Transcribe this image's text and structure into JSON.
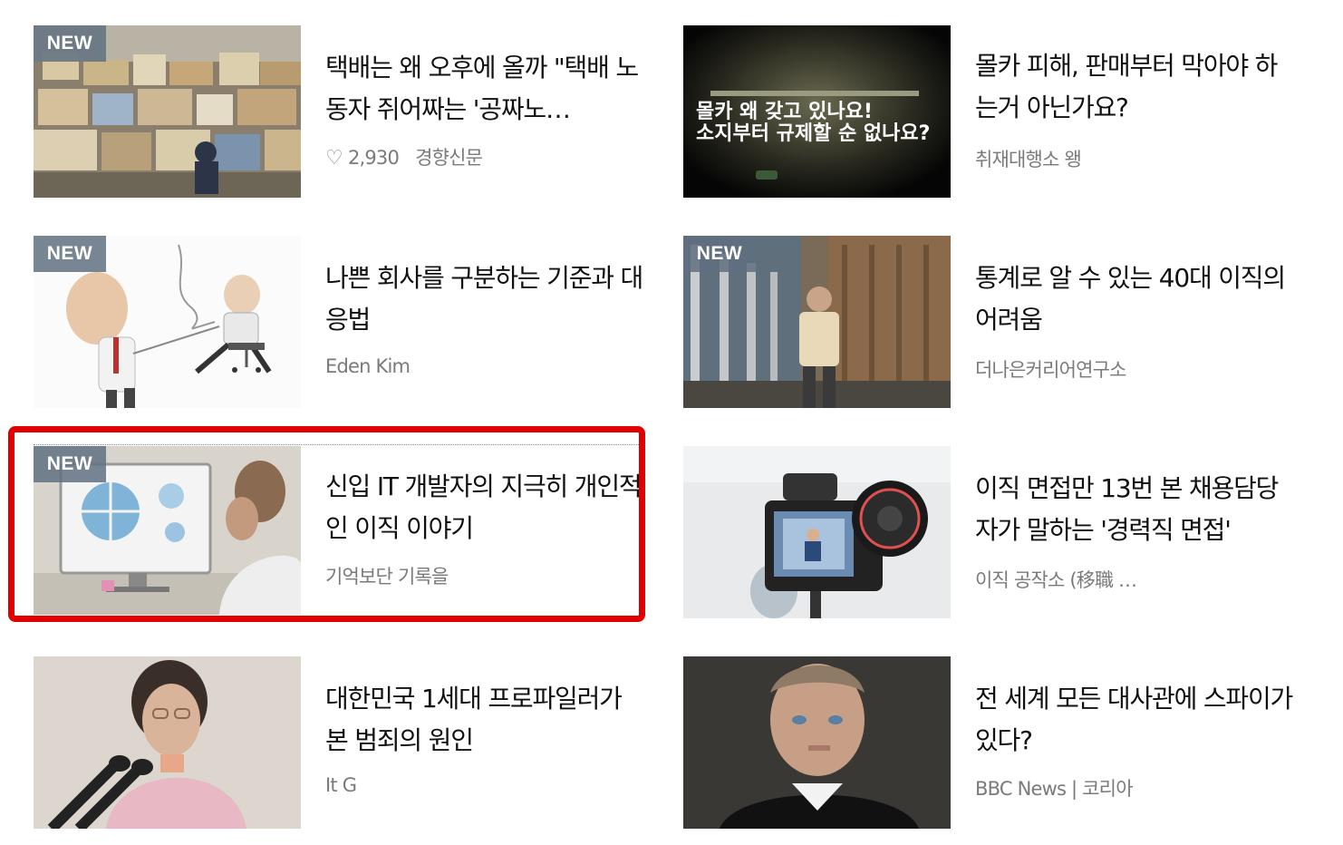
{
  "new_badge": "NEW",
  "highlight_color": "#e00000",
  "cards": [
    {
      "title": "택배는 왜 오후에 올까 \"택배 노동자 쥐어짜는 '공짜노…",
      "likes": "2,930",
      "source": "경향신문",
      "is_new": true
    },
    {
      "title": "몰카 피해, 판매부터 막아야 하는거 아닌가요?",
      "source": "취재대행소 왱",
      "is_new": false,
      "thumb_text_line1": "몰카 왜 갖고 있나요!",
      "thumb_text_line2": "소지부터 규제할 순 없나요?"
    },
    {
      "title": "나쁜 회사를 구분하는 기준과 대응법",
      "source": "Eden Kim",
      "is_new": true
    },
    {
      "title": "통계로 알 수 있는 40대 이직의 어려움",
      "source": "더나은커리어연구소",
      "is_new": true
    },
    {
      "title": "신입 IT 개발자의 지극히 개인적인 이직 이야기",
      "source": "기억보단 기록을",
      "is_new": true,
      "highlighted": true
    },
    {
      "title": "이직 면접만 13번 본 채용담당자가 말하는 '경력직 면접'",
      "source": "이직 공작소 (移職 …",
      "is_new": false
    },
    {
      "title": "대한민국 1세대 프로파일러가 본 범죄의 원인",
      "source": "It G",
      "is_new": false
    },
    {
      "title": "전 세계 모든 대사관에 스파이가 있다?",
      "source": "BBC News | 코리아",
      "is_new": false
    }
  ]
}
